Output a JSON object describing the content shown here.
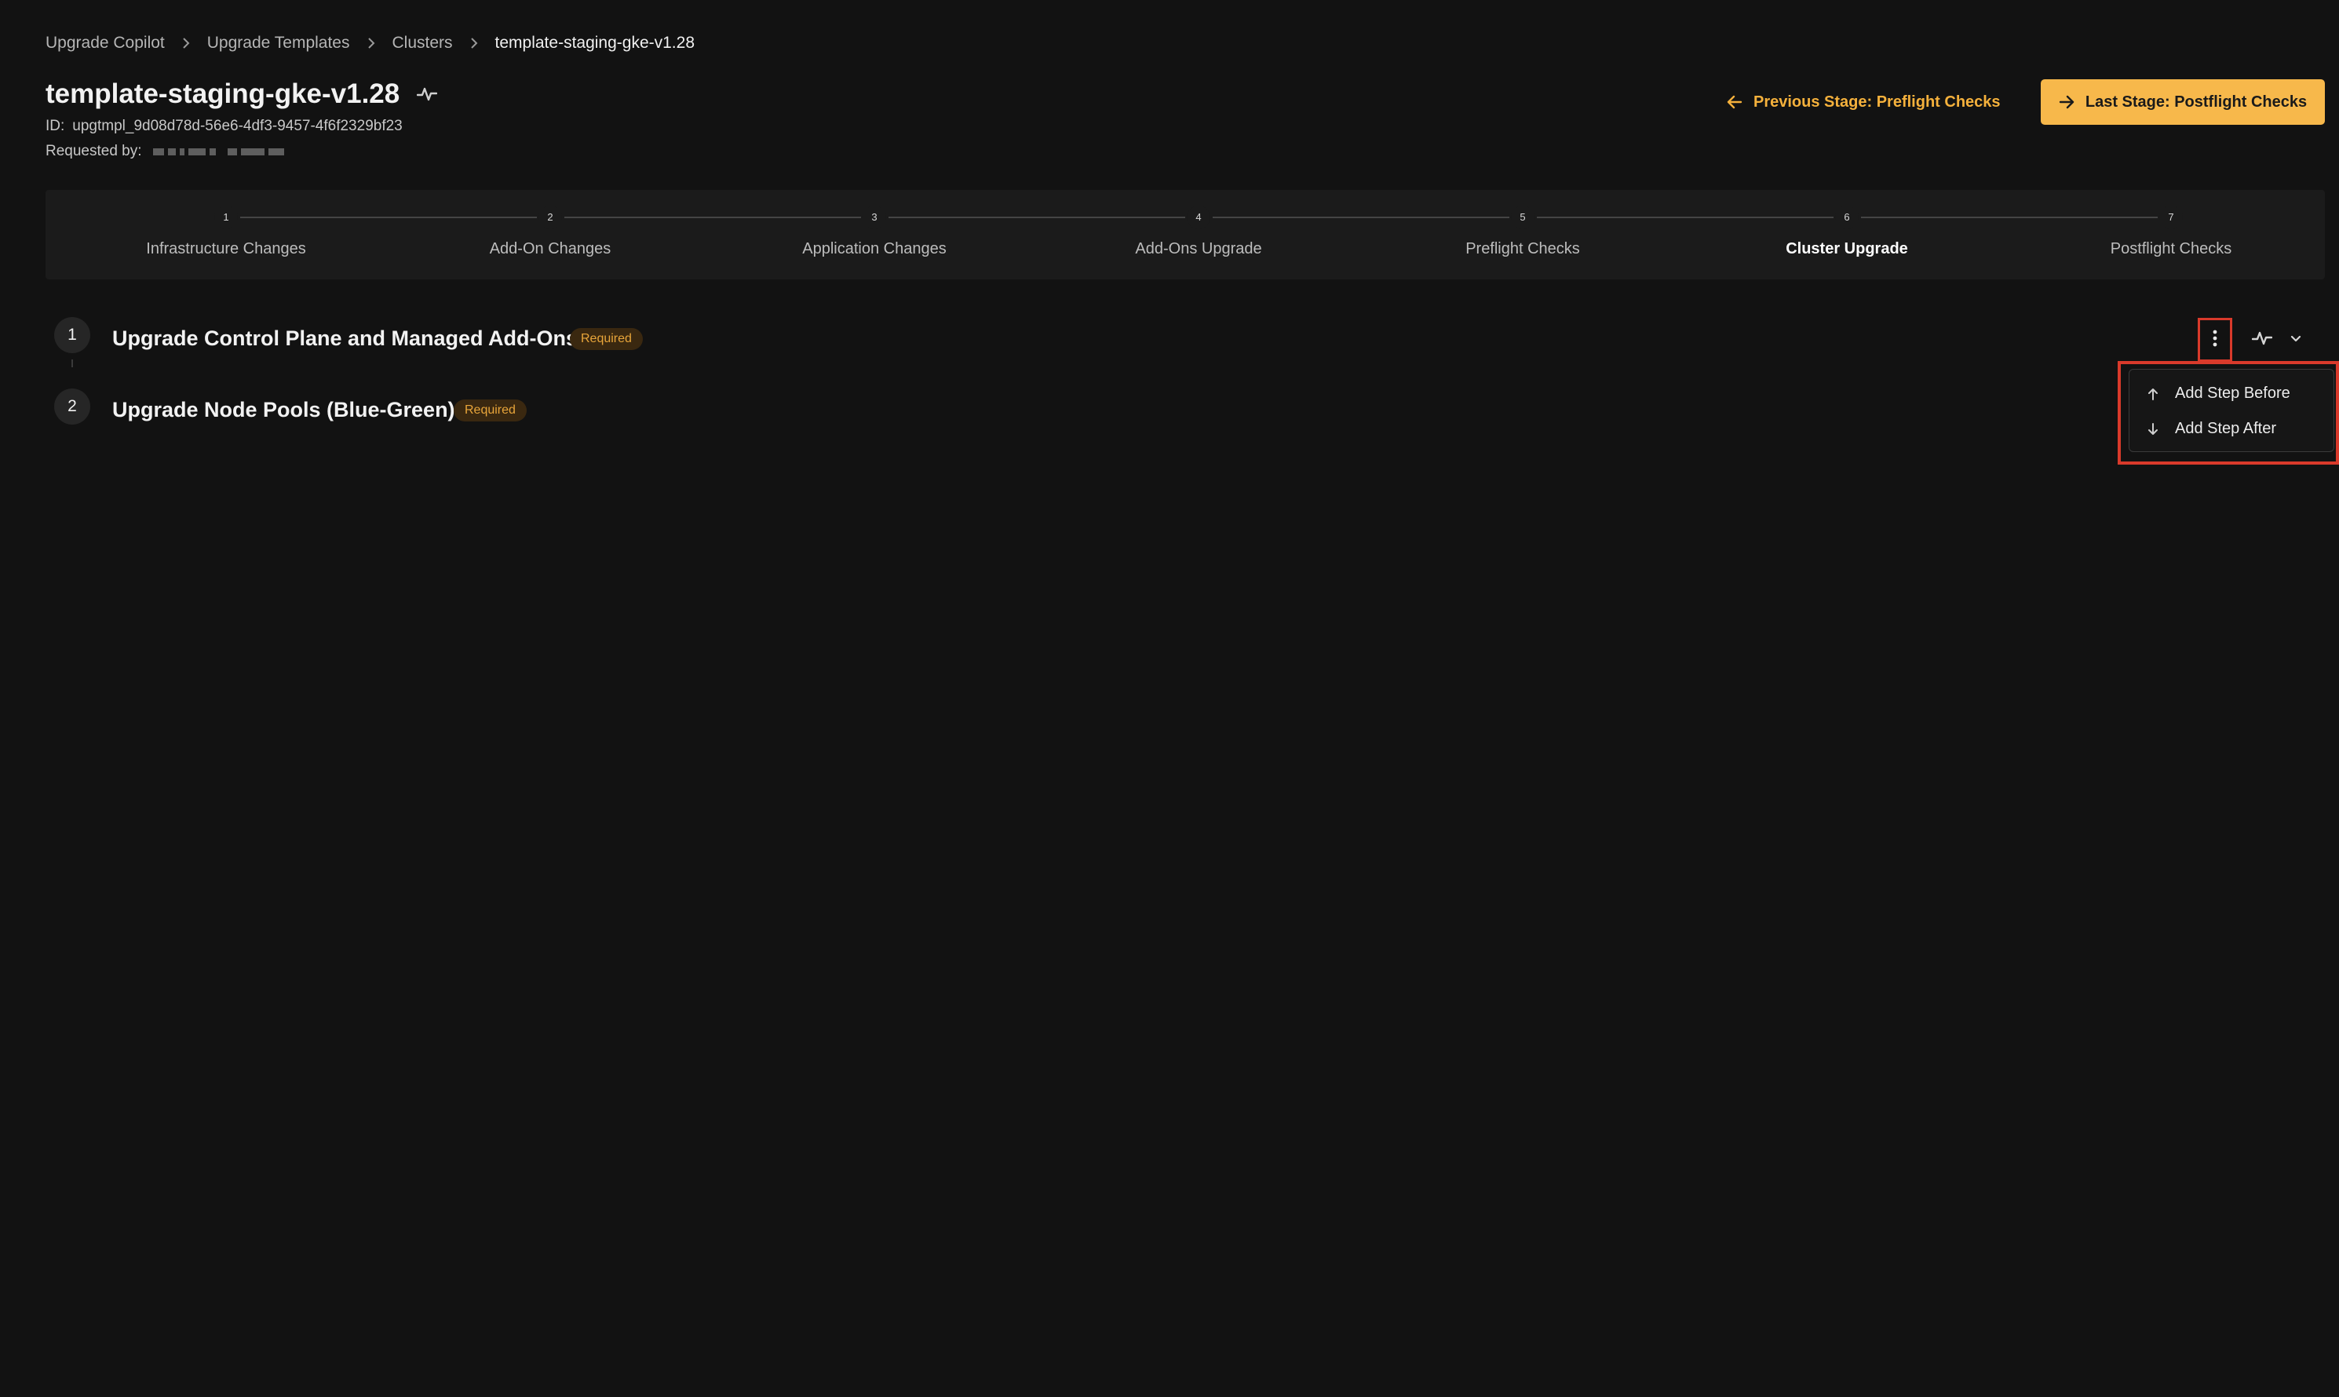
{
  "breadcrumb": [
    {
      "label": "Upgrade Copilot"
    },
    {
      "label": "Upgrade Templates"
    },
    {
      "label": "Clusters"
    },
    {
      "label": "template-staging-gke-v1.28"
    }
  ],
  "header": {
    "title": "template-staging-gke-v1.28",
    "id_label": "ID:",
    "id_value": "upgtmpl_9d08d78d-56e6-4df3-9457-4f6f2329bf23",
    "requested_by_label": "Requested by:"
  },
  "nav": {
    "previous_stage_label": "Previous Stage: Preflight Checks",
    "last_stage_label": "Last Stage: Postflight Checks"
  },
  "stages": [
    {
      "number": "1",
      "label": "Infrastructure Changes"
    },
    {
      "number": "2",
      "label": "Add-On Changes"
    },
    {
      "number": "3",
      "label": "Application Changes"
    },
    {
      "number": "4",
      "label": "Add-Ons Upgrade"
    },
    {
      "number": "5",
      "label": "Preflight Checks"
    },
    {
      "number": "6",
      "label": "Cluster Upgrade"
    },
    {
      "number": "7",
      "label": "Postflight Checks"
    }
  ],
  "active_stage": "Cluster Upgrade",
  "steps": [
    {
      "number": "1",
      "title": "Upgrade Control Plane and Managed Add-Ons",
      "badge": "Required"
    },
    {
      "number": "2",
      "title": "Upgrade Node Pools (Blue-Green)",
      "badge": "Required"
    }
  ],
  "step_menu": {
    "items": [
      {
        "label": "Add Step Before",
        "icon": "arrow-up-icon"
      },
      {
        "label": "Add Step After",
        "icon": "arrow-down-icon"
      }
    ]
  },
  "colors": {
    "background": "#121212",
    "accent": "#f7b84b",
    "badge_text": "#e8a53a",
    "highlight": "#d93a2b"
  }
}
